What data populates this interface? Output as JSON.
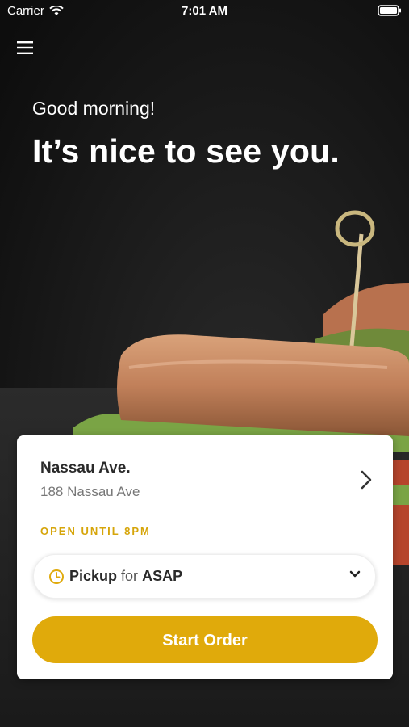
{
  "status_bar": {
    "carrier": "Carrier",
    "time": "7:01 AM"
  },
  "header": {
    "menu_icon": "hamburger-menu-icon",
    "greeting": "Good morning!",
    "headline": "It’s nice to see you."
  },
  "store": {
    "name": "Nassau Ave.",
    "address": "188 Nassau Ave",
    "status": "OPEN UNTIL 8PM"
  },
  "order_mode": {
    "mode": "Pickup",
    "connector": "for",
    "time": "ASAP",
    "icon": "clock-icon"
  },
  "actions": {
    "start_order": "Start Order"
  },
  "colors": {
    "accent": "#e0aa0b",
    "accent_text": "#d6a50a"
  }
}
